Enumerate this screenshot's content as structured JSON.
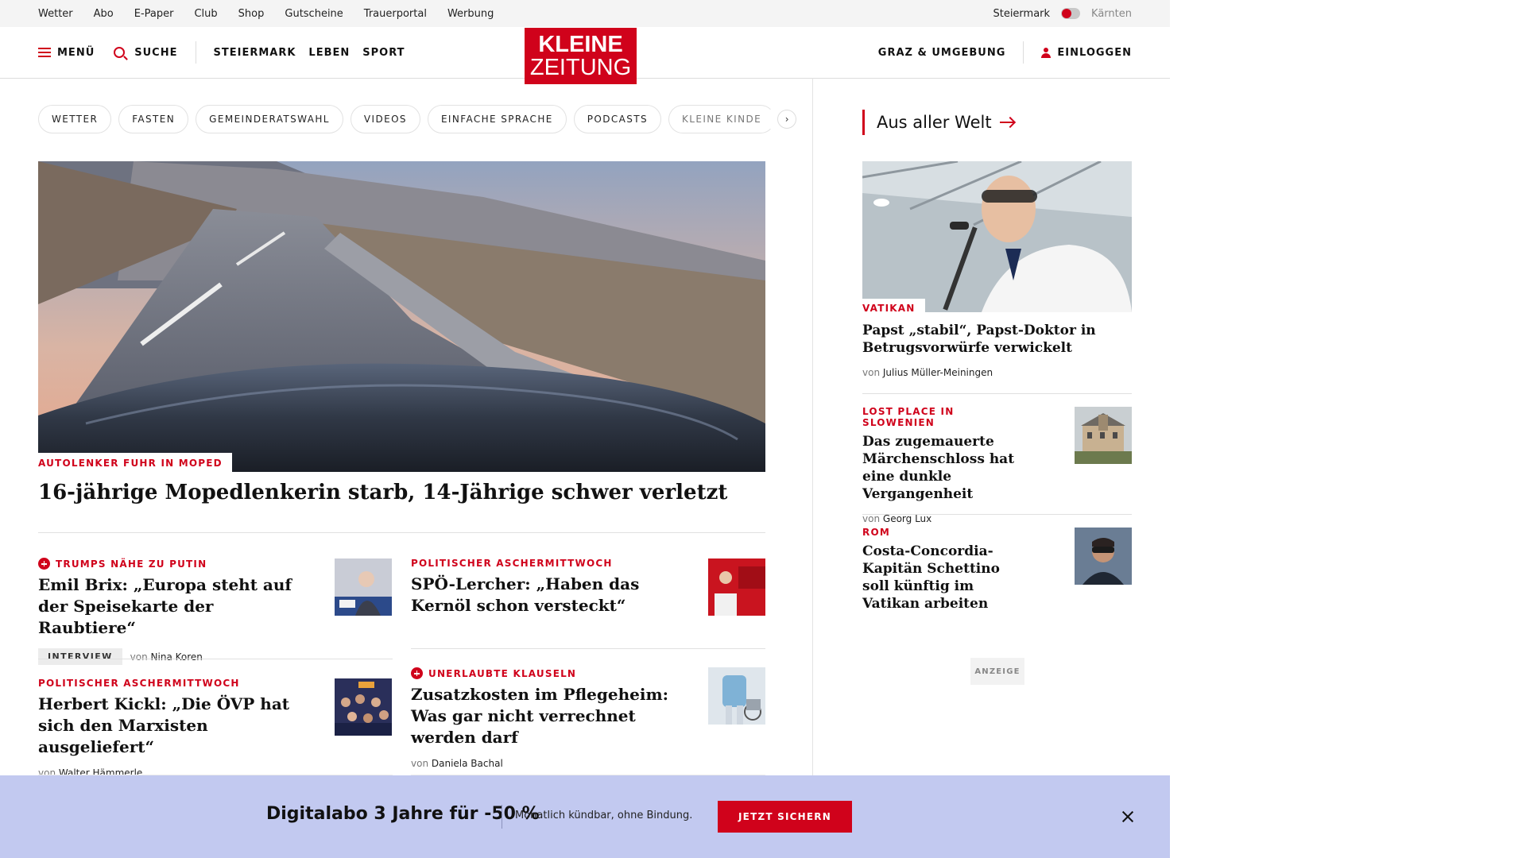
{
  "topbar": {
    "links": [
      "Wetter",
      "Abo",
      "E-Paper",
      "Club",
      "Shop",
      "Gutscheine",
      "Trauerportal",
      "Werbung"
    ],
    "region_left": "Steiermark",
    "region_right": "Kärnten"
  },
  "header": {
    "menu_label": "MENÜ",
    "search_label": "SUCHE",
    "nav": [
      "STEIERMARK",
      "LEBEN",
      "SPORT"
    ],
    "logo_line1": "KLEINE",
    "logo_line2": "ZEITUNG",
    "region_link": "GRAZ & UMGEBUNG",
    "login_label": "EINLOGGEN"
  },
  "chips": [
    "WETTER",
    "FASTEN",
    "GEMEINDERATSWAHL",
    "VIDEOS",
    "EINFACHE SPRACHE",
    "PODCASTS",
    "KLEINE KINDE"
  ],
  "hero": {
    "kicker": "AUTOLENKER FUHR IN MOPED",
    "title": "16-jährige Mopedlenkerin starb, 14-Jährige schwer verletzt"
  },
  "articles": [
    {
      "kicker": "TRUMPS NÄHE ZU PUTIN",
      "title": "Emil Brix: „Europa steht auf der Speisekarte der Raubtiere“",
      "badge": "INTERVIEW",
      "by": "von",
      "author": "Nina Koren"
    },
    {
      "kicker": "POLITISCHER ASCHERMITTWOCH",
      "title": "SPÖ-Lercher: „Haben das Kernöl schon versteckt“"
    },
    {
      "kicker": "POLITISCHER ASCHERMITTWOCH",
      "title": "Herbert Kickl: „Die ÖVP hat sich den Marxisten ausgeliefert“",
      "by": "von",
      "author": "Walter Hämmerle"
    },
    {
      "kicker": "UNERLAUBTE KLAUSELN",
      "title": "Zusatzkosten im Pflegeheim: Was gar nicht verrechnet werden darf",
      "by": "von",
      "author": "Daniela Bachal"
    }
  ],
  "sidebar": {
    "heading": "Aus aller Welt",
    "items": [
      {
        "kicker": "VATIKAN",
        "title": "Papst „stabil“, Papst-Doktor in Betrugsvorwürfe verwickelt",
        "by": "von",
        "author": "Julius Müller-Meiningen"
      },
      {
        "kicker": "LOST PLACE IN SLOWENIEN",
        "title": "Das zugemauerte Märchenschloss hat eine dunkle Vergangenheit",
        "by": "von",
        "author": "Georg Lux"
      },
      {
        "kicker": "ROM",
        "title": "Costa-Concordia-Kapitän Schettino soll künftig im Vatikan arbeiten"
      }
    ],
    "ad_label": "ANZEIGE"
  },
  "banner": {
    "title": "Digitalabo 3 Jahre für -50 %",
    "text": "Monatlich kündbar, ohne Bindung.",
    "button": "JETZT SICHERN"
  },
  "colors": {
    "accent": "#d0021b",
    "banner_bg": "#c2c9f0"
  }
}
